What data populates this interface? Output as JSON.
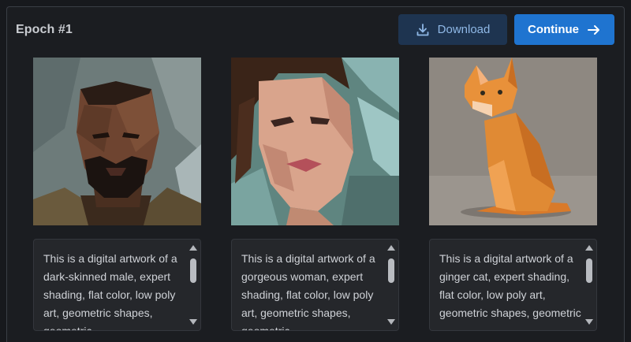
{
  "header": {
    "title": "Epoch #1",
    "download_label": "Download",
    "continue_label": "Continue"
  },
  "colors": {
    "background": "#17191d",
    "panel": "#1b1d21",
    "download_bg": "#1e3450",
    "download_text": "#8fb8e6",
    "continue_bg": "#1f74d0",
    "caption_bg": "#25272b"
  },
  "icons": {
    "download": "download-icon",
    "continue": "arrow-right-icon"
  },
  "cards": [
    {
      "image": "portrait-man-lowpoly",
      "caption": "This is a digital artwork of a dark-skinned male, expert shading, flat color, low poly art, geometric shapes, geometric"
    },
    {
      "image": "portrait-woman-lowpoly",
      "caption": "This is a digital artwork of a gorgeous woman, expert shading, flat color, low poly art, geometric shapes, geometric"
    },
    {
      "image": "ginger-cat-lowpoly",
      "caption": "This is a digital artwork of a ginger cat, expert shading, flat color, low poly art, geometric shapes, geometric"
    }
  ]
}
